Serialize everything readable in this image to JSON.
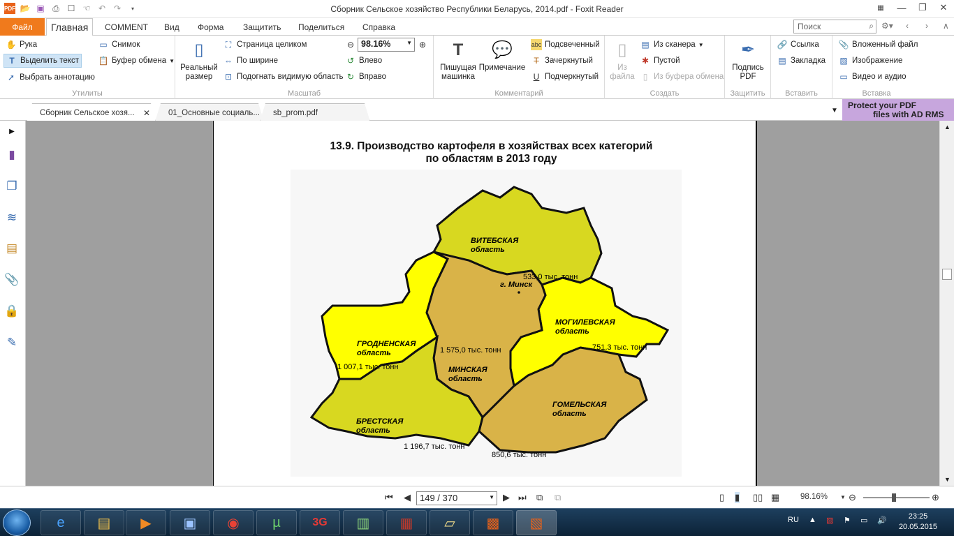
{
  "window": {
    "title": "Сборник Сельское хозяйство Республики Беларусь, 2014.pdf - Foxit Reader"
  },
  "ribbon_tabs": {
    "file": "Файл",
    "home": "Главная",
    "comment": "COMMENT",
    "view": "Вид",
    "form": "Форма",
    "protect": "Защитить",
    "share": "Поделиться",
    "help": "Справка"
  },
  "search": {
    "placeholder": "Поиск"
  },
  "groups": {
    "utilities": {
      "label": "Утилиты",
      "hand": "Рука",
      "select_text": "Выделить текст",
      "select_annotation": "Выбрать аннотацию",
      "snapshot": "Снимок",
      "clipboard": "Буфер обмена"
    },
    "zoom": {
      "label": "Масштаб",
      "actual_size": "Реальный размер",
      "fit_page": "Страница целиком",
      "fit_width": "По ширине",
      "fit_visible": "Подогнать видимую область",
      "zoom_value": "98.16%",
      "rotate_left": "Влево",
      "rotate_right": "Вправо"
    },
    "comment": {
      "label": "Комментарий",
      "typewriter": "Пишущая машинка",
      "note": "Примечание",
      "highlight": "Подсвеченный",
      "strikeout": "Зачеркнутый",
      "underline": "Подчеркнутый"
    },
    "create": {
      "label": "Создать",
      "from_file": "Из файла",
      "from_scanner": "Из сканера",
      "blank": "Пустой",
      "from_clipboard": "Из буфера обмена"
    },
    "protect": {
      "label": "Защитить",
      "sign": "Подпись PDF"
    },
    "insert": {
      "label": "Вставить",
      "link": "Ссылка",
      "bookmark": "Закладка"
    },
    "insert2": {
      "label": "Вставка",
      "attachment": "Вложенный файл",
      "image": "Изображение",
      "video": "Видео и аудио"
    }
  },
  "doc_tabs": [
    "Сборник Сельское хозя...",
    "01_Основные социаль...",
    "sb_prom.pdf"
  ],
  "ad": {
    "line1": "Protect your PDF",
    "line2": "files with AD RMS"
  },
  "page": {
    "title_line1": "13.9. Производство картофеля в хозяйствах всех категорий",
    "title_line2": "по областям в 2013 году",
    "minsk_city": "г. Минск",
    "regions": [
      {
        "name1": "ВИТЕБСКАЯ",
        "name2": "область",
        "value": "533,0 тыс. тонн",
        "color": "#d8d820"
      },
      {
        "name1": "МОГИЛЕВСКАЯ",
        "name2": "область",
        "value": "751,3 тыс. тонн",
        "color": "#ffff00"
      },
      {
        "name1": "ГРОДНЕНСКАЯ",
        "name2": "область",
        "value": "1 007,1 тыс. тонн",
        "color": "#ffff00"
      },
      {
        "name1": "МИНСКАЯ",
        "name2": "область",
        "value": "1 575,0 тыс. тонн",
        "color": "#d9b348"
      },
      {
        "name1": "БРЕСТСКАЯ",
        "name2": "область",
        "value": "1 196,7 тыс. тонн",
        "color": "#d8d820"
      },
      {
        "name1": "ГОМЕЛЬСКАЯ",
        "name2": "область",
        "value": "850,6 тыс. тонн",
        "color": "#d9b348"
      }
    ]
  },
  "status": {
    "page": "149 / 370",
    "zoom": "98.16%"
  },
  "taskbar": {
    "lang": "RU",
    "time": "23:25",
    "date": "20.05.2015"
  }
}
